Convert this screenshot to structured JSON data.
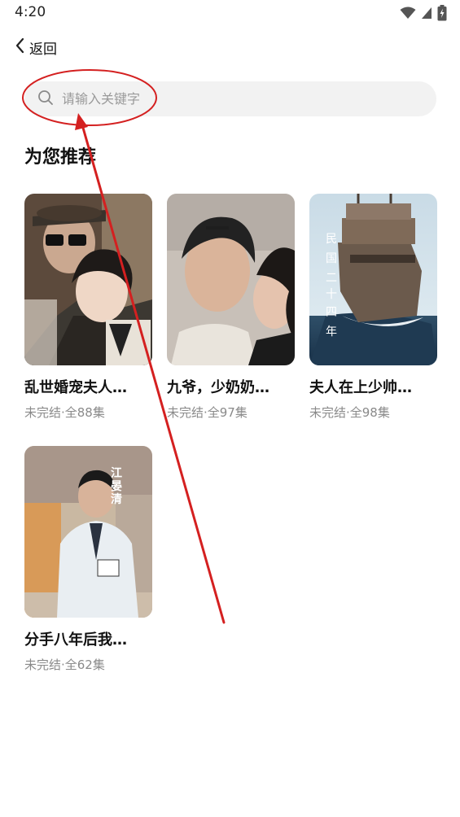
{
  "status_bar": {
    "time": "4:20",
    "wifi_icon": "wifi-icon",
    "signal_icon": "signal-icon",
    "battery_icon": "battery-charging-icon"
  },
  "nav": {
    "back_label": "返回",
    "back_icon": "chevron-left-icon"
  },
  "search": {
    "placeholder": "请输入关键字",
    "value": "",
    "icon": "search-icon"
  },
  "section": {
    "title": "为您推荐"
  },
  "dramas": [
    {
      "title": "乱世婚宠夫人…",
      "meta": "未完结·全88集"
    },
    {
      "title": "九爷，少奶奶…",
      "meta": "未完结·全97集"
    },
    {
      "title": "夫人在上少帅…",
      "meta": "未完结·全98集",
      "cover_text": [
        "民",
        "国",
        "二",
        "十",
        "四",
        "年"
      ]
    },
    {
      "title": "分手八年后我…",
      "meta": "未完结·全62集",
      "cover_text": [
        "江",
        "晏",
        "清"
      ]
    }
  ],
  "colors": {
    "annotation_red": "#d42020",
    "search_bg": "#f2f2f2",
    "meta_gray": "#8a8a8a"
  }
}
